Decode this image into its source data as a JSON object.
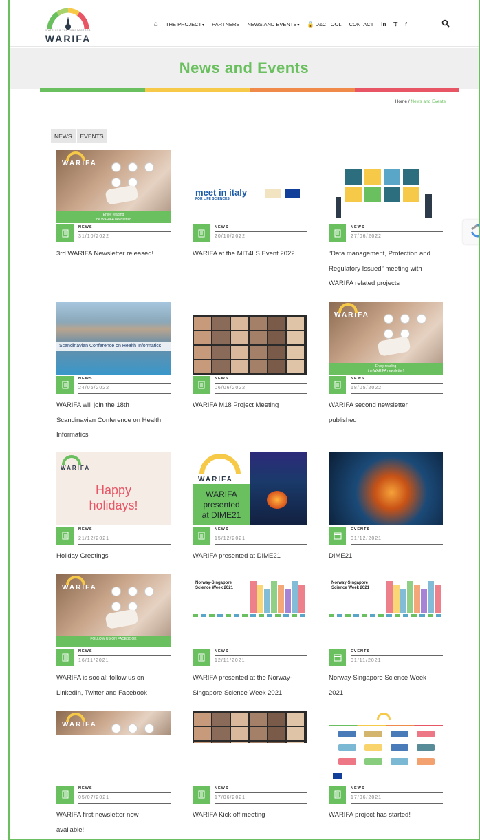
{
  "brand": {
    "name": "WARIFA",
    "tagline": "WATCHING THE RISK FACTORS"
  },
  "nav": {
    "items": [
      "THE PROJECT",
      "PARTNERS",
      "NEWS AND EVENTS",
      "D&C TOOL",
      "CONTACT"
    ],
    "social": [
      "in",
      "twitter",
      "f"
    ]
  },
  "page": {
    "title": "News and Events"
  },
  "breadcrumb": {
    "home": "Home",
    "sep": " / ",
    "current": "News and Events"
  },
  "filters": [
    "NEWS",
    "EVENTS"
  ],
  "colors": {
    "accent": "#6abf5e",
    "yellow": "#f7c948",
    "orange": "#f08a4b",
    "red": "#e85565"
  },
  "cards": [
    {
      "category": "NEWS",
      "date": "31/10/2022",
      "title_lines": [
        "3rd WARIFA Newsletter released!"
      ],
      "thumb_caption": [
        "Enjoy reading",
        "the WARIFA newsletter!"
      ]
    },
    {
      "category": "NEWS",
      "date": "20/10/2022",
      "title_lines": [
        "WARIFA at the MIT4LS Event 2022"
      ],
      "thumb_caption": [
        "meet in italy",
        "FOR LIFE SCIENCES"
      ]
    },
    {
      "category": "NEWS",
      "date": "27/06/2022",
      "title_lines": [
        "“Data management, Protection and",
        "Regulatory Issued” meeting with",
        "WARIFA related projects"
      ]
    },
    {
      "category": "NEWS",
      "date": "24/06/2022",
      "title_lines": [
        "WARIFA will join the 18th",
        "Scandinavian Conference on Health",
        "Informatics"
      ],
      "thumb_caption": [
        "Scandinavian Conference on Health Informatics"
      ]
    },
    {
      "category": "NEWS",
      "date": "06/06/2022",
      "title_lines": [
        "WARIFA M18 Project Meeting"
      ]
    },
    {
      "category": "NEWS",
      "date": "18/05/2022",
      "title_lines": [
        "WARIFA second newsletter",
        "published"
      ],
      "thumb_caption": [
        "Enjoy reading",
        "the WARIFA newsletter!"
      ]
    },
    {
      "category": "NEWS",
      "date": "21/12/2021",
      "title_lines": [
        "Holiday Greetings"
      ],
      "thumb_caption": [
        "Happy",
        "holidays!"
      ]
    },
    {
      "category": "NEWS",
      "date": "15/12/2021",
      "title_lines": [
        "WARIFA presented at DIME21"
      ],
      "thumb_caption": [
        "WARIFA",
        "presented",
        "at DIME21"
      ]
    },
    {
      "category": "EVENTS",
      "date": "01/12/2021",
      "title_lines": [
        "DIME21"
      ]
    },
    {
      "category": "NEWS",
      "date": "16/11/2021",
      "title_lines": [
        "WARIFA is social: follow us on",
        "LinkedIn, Twitter and Facebook"
      ],
      "thumb_caption": [
        "FOLLOW US ON FACEBOOK"
      ]
    },
    {
      "category": "NEWS",
      "date": "12/11/2021",
      "title_lines": [
        "WARIFA presented at the Norway-",
        "Singapore Science Week 2021"
      ],
      "thumb_caption": [
        "Norway-Singapore",
        "Science Week 2021"
      ]
    },
    {
      "category": "EVENTS",
      "date": "01/11/2021",
      "title_lines": [
        "Norway-Singapore Science Week",
        "2021"
      ],
      "thumb_caption": [
        "Norway-Singapore",
        "Science Week 2021"
      ]
    },
    {
      "category": "NEWS",
      "date": "05/07/2021",
      "title_lines": [
        "WARIFA first newsletter now",
        "available!"
      ]
    },
    {
      "category": "NEWS",
      "date": "17/06/2021",
      "title_lines": [
        "WARIFA Kick off meeting"
      ]
    },
    {
      "category": "NEWS",
      "date": "17/06/2021",
      "title_lines": [
        "WARIFA project has started!"
      ]
    }
  ]
}
